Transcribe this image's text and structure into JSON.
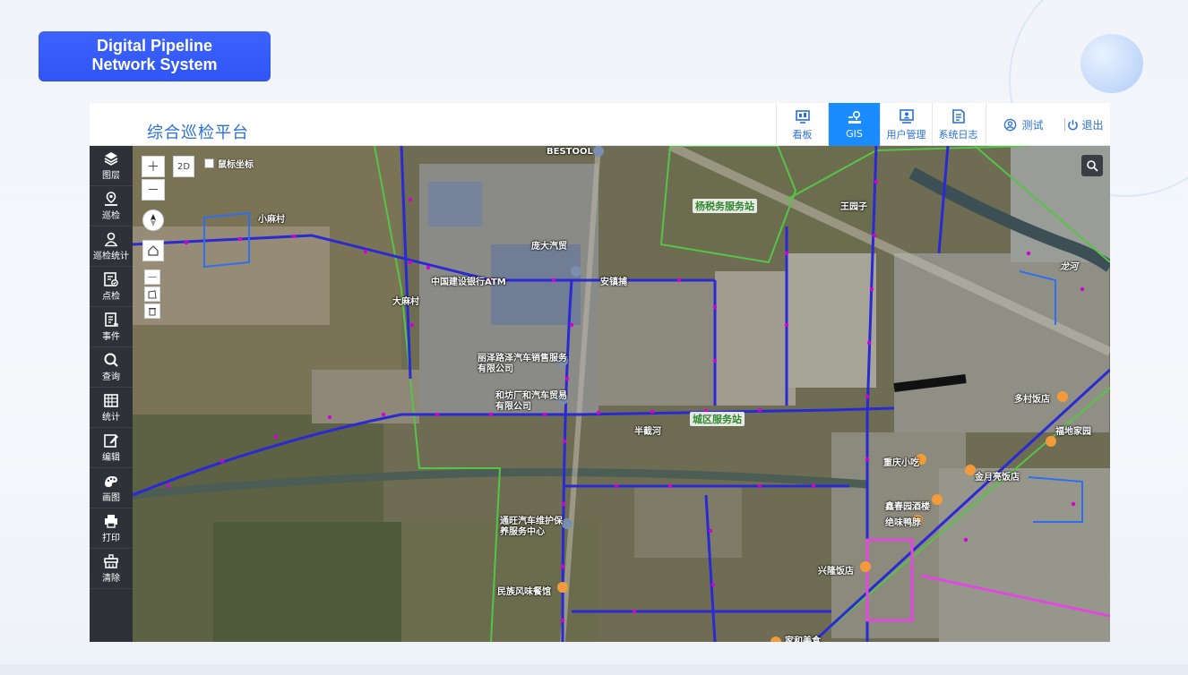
{
  "badge": {
    "line1": "Digital Pipeline",
    "line2": "Network System"
  },
  "app": {
    "platform_title": "综合巡检平台",
    "nav": [
      {
        "label": "看板",
        "icon": "dashboard-icon"
      },
      {
        "label": "GIS",
        "icon": "gis-pin-icon",
        "active": true
      },
      {
        "label": "用户管理",
        "icon": "user-manage-icon"
      },
      {
        "label": "系统日志",
        "icon": "system-log-icon"
      }
    ],
    "user_label": "测试",
    "logout_label": "退出",
    "accent_color": "#1a8cff"
  },
  "sidebar": [
    {
      "label": "图层",
      "icon": "layers-icon"
    },
    {
      "label": "巡检",
      "icon": "inspection-pin-icon"
    },
    {
      "label": "巡检统计",
      "icon": "inspection-stats-icon"
    },
    {
      "label": "点检",
      "icon": "point-check-icon"
    },
    {
      "label": "事件",
      "icon": "event-icon"
    },
    {
      "label": "查询",
      "icon": "search-icon"
    },
    {
      "label": "统计",
      "icon": "statistics-icon"
    },
    {
      "label": "编辑",
      "icon": "edit-icon"
    },
    {
      "label": "画图",
      "icon": "draw-icon"
    },
    {
      "label": "打印",
      "icon": "print-icon"
    },
    {
      "label": "清除",
      "icon": "clear-icon"
    }
  ],
  "map": {
    "view_mode": "2D",
    "coord_toggle_label": "鼠标坐标",
    "labels": [
      "BESTOOL",
      "小麻村",
      "大麻村",
      "庞大汽贸",
      "中国建设银行ATM",
      "安镇捕",
      "丽泽路泽汽车销售服务有限公司",
      "和坊厂和汽车贸易有限公司",
      "半截河",
      "通旺汽车维护保养服务中心",
      "民族风味餐馆",
      "王园子",
      "多村饭店",
      "福地家园",
      "重庆小吃",
      "金月亮饭店",
      "鑫春园酒楼",
      "绝味鸭脖",
      "兴隆饭店",
      "家和美食",
      "龙河",
      "杨税务服务站",
      "城区服务站"
    ]
  }
}
